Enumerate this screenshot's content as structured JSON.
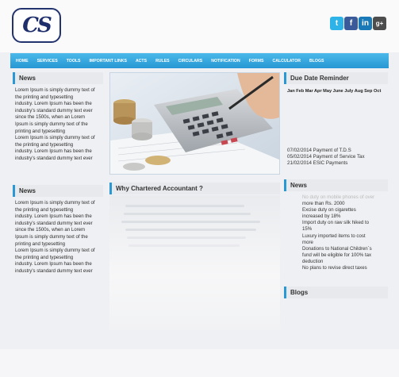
{
  "logo": {
    "text": "CS"
  },
  "social": [
    {
      "name": "twitter-icon",
      "glyph": "t"
    },
    {
      "name": "facebook-icon",
      "glyph": "f"
    },
    {
      "name": "linkedin-icon",
      "glyph": "in"
    },
    {
      "name": "googleplus-icon",
      "glyph": "g+"
    }
  ],
  "nav": [
    "HOME",
    "SERVICES",
    "TOOLS",
    "IMPORTANT LINKS",
    "ACTS",
    "RULES",
    "CIRCULARS",
    "NOTIFICATION",
    "FORMS",
    "CALCULATOR",
    "BLOGS"
  ],
  "news_left_1": {
    "title": "News",
    "lines": [
      "Lorem Ipsum is simply dummy text of",
      "the printing and typesetting",
      "industry. Lorem Ipsum has been the",
      "industry's standard dummy text ever",
      "since the 1500s, when an Lorem",
      "Ipsum is simply dummy text of the",
      "printing and typesetting",
      "Lorem Ipsum is simply dummy text of",
      "the printing and typesetting",
      "industry. Lorem Ipsum has been the",
      "industry's standard dummy text ever"
    ]
  },
  "news_left_2": {
    "title": "News",
    "lines": [
      "Lorem Ipsum is simply dummy text of",
      "the printing and typesetting",
      "industry. Lorem Ipsum has been the",
      "industry's standard dummy text ever",
      "since the 1500s, when an Lorem",
      "Ipsum is simply dummy text of the",
      "printing and typesetting",
      "Lorem Ipsum is simply dummy text of",
      "the printing and typesetting",
      "industry. Lorem Ipsum has been the",
      "industry's standard dummy text ever"
    ]
  },
  "why": {
    "title": "Why Chartered Accountant ?"
  },
  "due": {
    "title": "Due Date Reminder",
    "months": "Jan Feb Mar Apr May June July Aug Sep Oct",
    "items": [
      "07/02/2014 Payment of T.D.S",
      "05/02/2014 Payment of Service Tax",
      "21/02/2014 ESIC Payments"
    ]
  },
  "news_right": {
    "title": "News",
    "faded_line": "No duty on mobile phones of over",
    "items": [
      "more than Rs. 2000",
      "Excise duty on cigarettes",
      "increased by 18%",
      "Import duty on raw silk hiked to",
      "15%",
      "Luxury imported items to cost",
      "more",
      "Donations to National Children`s",
      "fund will be eligible for 100% tax",
      "deduction",
      "No plans to revise direct taxes"
    ]
  },
  "blogs": {
    "title": "Blogs"
  }
}
